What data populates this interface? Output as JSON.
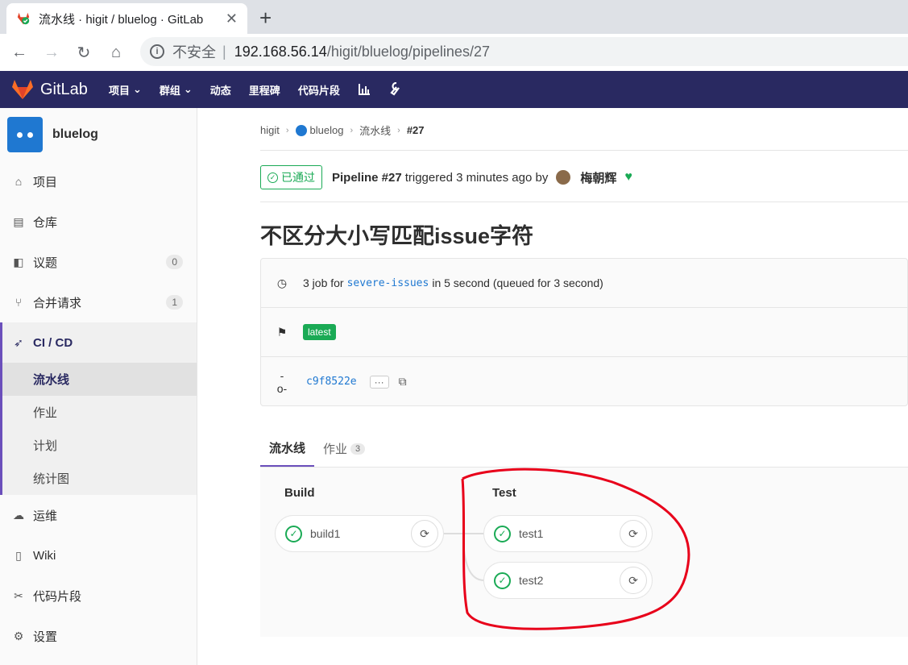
{
  "browser": {
    "tab_title": "流水线 · higit / bluelog · GitLab",
    "close_glyph": "✕",
    "new_tab_glyph": "+",
    "insecure_label": "不安全",
    "separator": "|",
    "url_host": "192.168.56.14",
    "url_path": "/higit/bluelog/pipelines/27"
  },
  "topnav": {
    "brand": "GitLab",
    "items": [
      "项目",
      "群组",
      "动态",
      "里程碑",
      "代码片段"
    ]
  },
  "sidebar": {
    "project_name": "bluelog",
    "items": [
      {
        "label": "项目",
        "icon": "home-icon"
      },
      {
        "label": "仓库",
        "icon": "doc-icon"
      },
      {
        "label": "议题",
        "icon": "issues-icon",
        "count": "0"
      },
      {
        "label": "合并请求",
        "icon": "merge-icon",
        "count": "1"
      }
    ],
    "ci": {
      "label": "CI / CD",
      "subitems": [
        "流水线",
        "作业",
        "计划",
        "统计图"
      ]
    },
    "items_after": [
      {
        "label": "运维",
        "icon": "cloud-icon"
      },
      {
        "label": "Wiki",
        "icon": "book-icon"
      },
      {
        "label": "代码片段",
        "icon": "scissors-icon"
      },
      {
        "label": "设置",
        "icon": "gear-icon"
      }
    ]
  },
  "breadcrumb": [
    "higit",
    "bluelog",
    "流水线",
    "#27"
  ],
  "pipeline": {
    "status": "已通过",
    "label": "Pipeline #27",
    "triggered": "triggered 3 minutes ago by",
    "user": "梅朝辉",
    "title": "不区分大小写匹配issue字符",
    "jobs_prefix": "3 job for",
    "branch": "severe-issues",
    "jobs_suffix": "in 5 second (queued for 3 second)",
    "tag": "latest",
    "commit": "c9f8522e",
    "ellipsis": "···"
  },
  "tabs": [
    {
      "label": "流水线"
    },
    {
      "label": "作业",
      "count": "3"
    }
  ],
  "stages": [
    {
      "name": "Build",
      "jobs": [
        "build1"
      ]
    },
    {
      "name": "Test",
      "jobs": [
        "test1",
        "test2"
      ]
    }
  ]
}
